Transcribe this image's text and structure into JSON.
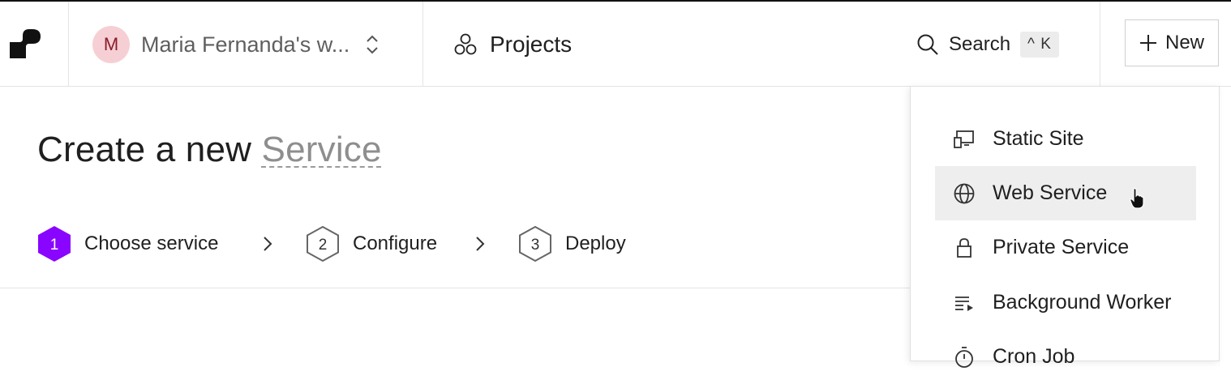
{
  "header": {
    "workspace": {
      "avatar_initial": "M",
      "name": "Maria Fernanda's w..."
    },
    "projects_label": "Projects",
    "search": {
      "label": "Search",
      "shortcut": "^ K"
    },
    "new_button_label": "New"
  },
  "main": {
    "title_prefix": "Create a new",
    "title_accent": "Service",
    "steps": [
      {
        "number": "1",
        "label": "Choose service",
        "state": "active"
      },
      {
        "number": "2",
        "label": "Configure",
        "state": "pending"
      },
      {
        "number": "3",
        "label": "Deploy",
        "state": "pending"
      }
    ]
  },
  "menu": {
    "items": [
      {
        "label": "Static Site",
        "icon": "static-site-icon"
      },
      {
        "label": "Web Service",
        "icon": "globe-icon",
        "hovered": true
      },
      {
        "label": "Private Service",
        "icon": "lock-icon"
      },
      {
        "label": "Background Worker",
        "icon": "background-worker-icon"
      },
      {
        "label": "Cron Job",
        "icon": "stopwatch-icon"
      }
    ]
  },
  "colors": {
    "active_step": "#8a05ff",
    "avatar_bg": "#f6cfd4",
    "hover_bg": "#eeeeee",
    "border": "#e4e4e4"
  }
}
